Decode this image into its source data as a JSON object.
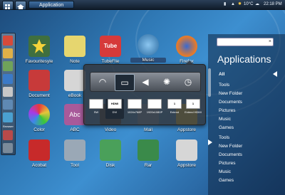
{
  "topbar": {
    "title": "Application",
    "temperature": "10°C",
    "time": "22:18 PM"
  },
  "sidebar": {
    "items": [
      {
        "icon": "calendar-icon",
        "color": "#d64a3a"
      },
      {
        "icon": "folder-icon",
        "color": "#e0b048"
      },
      {
        "icon": "document-icon",
        "color": "#6fa35a"
      },
      {
        "icon": "browser-icon",
        "color": "#3b7ac7"
      },
      {
        "icon": "pencil-icon",
        "color": "#c7c7c7"
      },
      {
        "icon": "monitor-icon",
        "color": "#5f89b3"
      },
      {
        "icon": "globe-icon",
        "color": "#4aa0d0"
      },
      {
        "icon": "disk-icon",
        "color": "#b84a4a"
      },
      {
        "icon": "tools-icon",
        "color": "#7a8a9a"
      }
    ],
    "label": "Browser"
  },
  "apps": [
    {
      "label": "Favouritesyle",
      "icon": "star-icon",
      "color": "#3f6f3f"
    },
    {
      "label": "Note",
      "icon": "note-icon",
      "color": "#e6d66f"
    },
    {
      "label": "TubeFlie",
      "icon": "tube-icon",
      "color": "#d63a3a"
    },
    {
      "label": "Music",
      "icon": "music-icon",
      "color": "#3a8ad0"
    },
    {
      "label": "Firefox",
      "icon": "firefox-icon",
      "color": "#e67a2a"
    },
    {
      "label": "Document",
      "icon": "document-icon",
      "color": "#c73a3a"
    },
    {
      "label": "eBook",
      "icon": "ebook-icon",
      "color": "#d6d6d6"
    },
    {
      "label": "Color",
      "icon": "palette-icon",
      "color": "#e6b83a"
    },
    {
      "label": "ABC",
      "icon": "abc-icon",
      "color": "#a85a9a"
    },
    {
      "label": "Video",
      "icon": "video-icon",
      "color": "#3a3a3a"
    },
    {
      "label": "Mail",
      "icon": "mail-icon",
      "color": "#7a9ab8"
    },
    {
      "label": "Appstore",
      "icon": "appstore-icon",
      "color": "#e6c63a"
    },
    {
      "label": "Acobat",
      "icon": "acrobat-icon",
      "color": "#c72a2a"
    },
    {
      "label": "Tool",
      "icon": "tool-icon",
      "color": "#9aa8b6"
    },
    {
      "label": "Disk",
      "icon": "disk-icon",
      "color": "#4aa05a"
    },
    {
      "label": "Rar",
      "icon": "rar-icon",
      "color": "#3a8a4a"
    },
    {
      "label": "Appstore",
      "icon": "appstore-icon",
      "color": "#d6d6d6"
    }
  ],
  "right": {
    "search_placeholder": "",
    "title": "Applications",
    "categories": [
      "All",
      "Tools",
      "New Folder",
      "Documents",
      "Pictures",
      "Music",
      "Games",
      "Tools",
      "New Folder",
      "Documents",
      "Pictures",
      "Music",
      "Games"
    ]
  },
  "popup": {
    "row1": [
      "wifi-icon",
      "screen-icon",
      "volume-icon",
      "brightness-icon",
      "timer-icon"
    ],
    "modes": [
      {
        "label": "SW",
        "screen": ""
      },
      {
        "label": "DVI",
        "screen": "HDMI"
      },
      {
        "label": "1024x768P",
        "screen": ""
      },
      {
        "label": "1920x1080P",
        "screen": ""
      },
      {
        "label": "Extend",
        "screen": "1"
      },
      {
        "label": "Extend HDMI",
        "screen": "1"
      }
    ]
  }
}
